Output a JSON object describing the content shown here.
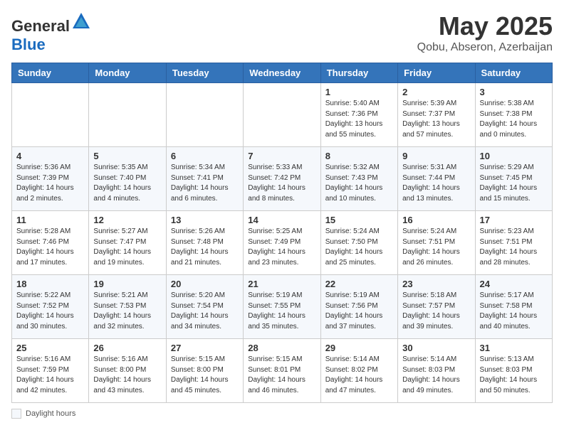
{
  "header": {
    "logo_general": "General",
    "logo_blue": "Blue",
    "month": "May 2025",
    "location": "Qobu, Abseron, Azerbaijan"
  },
  "days_of_week": [
    "Sunday",
    "Monday",
    "Tuesday",
    "Wednesday",
    "Thursday",
    "Friday",
    "Saturday"
  ],
  "footer": {
    "note_label": "Daylight hours"
  },
  "weeks": [
    {
      "days": [
        {
          "number": "",
          "info": ""
        },
        {
          "number": "",
          "info": ""
        },
        {
          "number": "",
          "info": ""
        },
        {
          "number": "",
          "info": ""
        },
        {
          "number": "1",
          "info": "Sunrise: 5:40 AM\nSunset: 7:36 PM\nDaylight: 13 hours\nand 55 minutes."
        },
        {
          "number": "2",
          "info": "Sunrise: 5:39 AM\nSunset: 7:37 PM\nDaylight: 13 hours\nand 57 minutes."
        },
        {
          "number": "3",
          "info": "Sunrise: 5:38 AM\nSunset: 7:38 PM\nDaylight: 14 hours\nand 0 minutes."
        }
      ]
    },
    {
      "days": [
        {
          "number": "4",
          "info": "Sunrise: 5:36 AM\nSunset: 7:39 PM\nDaylight: 14 hours\nand 2 minutes."
        },
        {
          "number": "5",
          "info": "Sunrise: 5:35 AM\nSunset: 7:40 PM\nDaylight: 14 hours\nand 4 minutes."
        },
        {
          "number": "6",
          "info": "Sunrise: 5:34 AM\nSunset: 7:41 PM\nDaylight: 14 hours\nand 6 minutes."
        },
        {
          "number": "7",
          "info": "Sunrise: 5:33 AM\nSunset: 7:42 PM\nDaylight: 14 hours\nand 8 minutes."
        },
        {
          "number": "8",
          "info": "Sunrise: 5:32 AM\nSunset: 7:43 PM\nDaylight: 14 hours\nand 10 minutes."
        },
        {
          "number": "9",
          "info": "Sunrise: 5:31 AM\nSunset: 7:44 PM\nDaylight: 14 hours\nand 13 minutes."
        },
        {
          "number": "10",
          "info": "Sunrise: 5:29 AM\nSunset: 7:45 PM\nDaylight: 14 hours\nand 15 minutes."
        }
      ]
    },
    {
      "days": [
        {
          "number": "11",
          "info": "Sunrise: 5:28 AM\nSunset: 7:46 PM\nDaylight: 14 hours\nand 17 minutes."
        },
        {
          "number": "12",
          "info": "Sunrise: 5:27 AM\nSunset: 7:47 PM\nDaylight: 14 hours\nand 19 minutes."
        },
        {
          "number": "13",
          "info": "Sunrise: 5:26 AM\nSunset: 7:48 PM\nDaylight: 14 hours\nand 21 minutes."
        },
        {
          "number": "14",
          "info": "Sunrise: 5:25 AM\nSunset: 7:49 PM\nDaylight: 14 hours\nand 23 minutes."
        },
        {
          "number": "15",
          "info": "Sunrise: 5:24 AM\nSunset: 7:50 PM\nDaylight: 14 hours\nand 25 minutes."
        },
        {
          "number": "16",
          "info": "Sunrise: 5:24 AM\nSunset: 7:51 PM\nDaylight: 14 hours\nand 26 minutes."
        },
        {
          "number": "17",
          "info": "Sunrise: 5:23 AM\nSunset: 7:51 PM\nDaylight: 14 hours\nand 28 minutes."
        }
      ]
    },
    {
      "days": [
        {
          "number": "18",
          "info": "Sunrise: 5:22 AM\nSunset: 7:52 PM\nDaylight: 14 hours\nand 30 minutes."
        },
        {
          "number": "19",
          "info": "Sunrise: 5:21 AM\nSunset: 7:53 PM\nDaylight: 14 hours\nand 32 minutes."
        },
        {
          "number": "20",
          "info": "Sunrise: 5:20 AM\nSunset: 7:54 PM\nDaylight: 14 hours\nand 34 minutes."
        },
        {
          "number": "21",
          "info": "Sunrise: 5:19 AM\nSunset: 7:55 PM\nDaylight: 14 hours\nand 35 minutes."
        },
        {
          "number": "22",
          "info": "Sunrise: 5:19 AM\nSunset: 7:56 PM\nDaylight: 14 hours\nand 37 minutes."
        },
        {
          "number": "23",
          "info": "Sunrise: 5:18 AM\nSunset: 7:57 PM\nDaylight: 14 hours\nand 39 minutes."
        },
        {
          "number": "24",
          "info": "Sunrise: 5:17 AM\nSunset: 7:58 PM\nDaylight: 14 hours\nand 40 minutes."
        }
      ]
    },
    {
      "days": [
        {
          "number": "25",
          "info": "Sunrise: 5:16 AM\nSunset: 7:59 PM\nDaylight: 14 hours\nand 42 minutes."
        },
        {
          "number": "26",
          "info": "Sunrise: 5:16 AM\nSunset: 8:00 PM\nDaylight: 14 hours\nand 43 minutes."
        },
        {
          "number": "27",
          "info": "Sunrise: 5:15 AM\nSunset: 8:00 PM\nDaylight: 14 hours\nand 45 minutes."
        },
        {
          "number": "28",
          "info": "Sunrise: 5:15 AM\nSunset: 8:01 PM\nDaylight: 14 hours\nand 46 minutes."
        },
        {
          "number": "29",
          "info": "Sunrise: 5:14 AM\nSunset: 8:02 PM\nDaylight: 14 hours\nand 47 minutes."
        },
        {
          "number": "30",
          "info": "Sunrise: 5:14 AM\nSunset: 8:03 PM\nDaylight: 14 hours\nand 49 minutes."
        },
        {
          "number": "31",
          "info": "Sunrise: 5:13 AM\nSunset: 8:03 PM\nDaylight: 14 hours\nand 50 minutes."
        }
      ]
    }
  ]
}
